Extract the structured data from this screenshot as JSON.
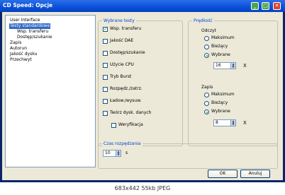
{
  "window": {
    "title": "CD Speed: Opcje"
  },
  "tree": {
    "items": [
      {
        "label": "User Interface",
        "selected": false
      },
      {
        "label": "Testy standardowe",
        "selected": true
      },
      {
        "label": "Wsp. transferu",
        "selected": false
      },
      {
        "label": "Dostęp/szukanie",
        "selected": false
      },
      {
        "label": "Zapis",
        "selected": false
      },
      {
        "label": "Autorun",
        "selected": false
      },
      {
        "label": "Jakość dysku",
        "selected": false
      },
      {
        "label": "Przechwyt",
        "selected": false
      }
    ]
  },
  "tests": {
    "title": "Wybrane testy",
    "items": [
      {
        "label": "Wsp. transferu",
        "checked": true
      },
      {
        "label": "Jakość DAE",
        "checked": false
      },
      {
        "label": "Dostęp/szukanie",
        "checked": false
      },
      {
        "label": "Użycie CPU",
        "checked": false
      },
      {
        "label": "Tryb Burst",
        "checked": false
      },
      {
        "label": "Rozpędz./zatrz.",
        "checked": false
      },
      {
        "label": "Ładow./wysuw.",
        "checked": false
      },
      {
        "label": "Twórz dysk. danych",
        "checked": false
      },
      {
        "label": "Weryfikacja",
        "checked": false
      }
    ]
  },
  "speed": {
    "title": "Prędkość",
    "read": {
      "label": "Odczyt",
      "options": [
        "Maksimum",
        "Bieżący",
        "Wybrane"
      ],
      "selected": 2,
      "value": "16"
    },
    "write": {
      "label": "Zapis",
      "options": [
        "Maksimum",
        "Bieżący",
        "Wybrane"
      ],
      "selected": 2,
      "value": "8"
    },
    "x_label": "X"
  },
  "delay": {
    "title": "Czas rozpędzania",
    "value": "10",
    "unit": "s"
  },
  "buttons": {
    "ok": "OK",
    "cancel": "Anuluj"
  },
  "caption": "683x442 55kb JPEG"
}
